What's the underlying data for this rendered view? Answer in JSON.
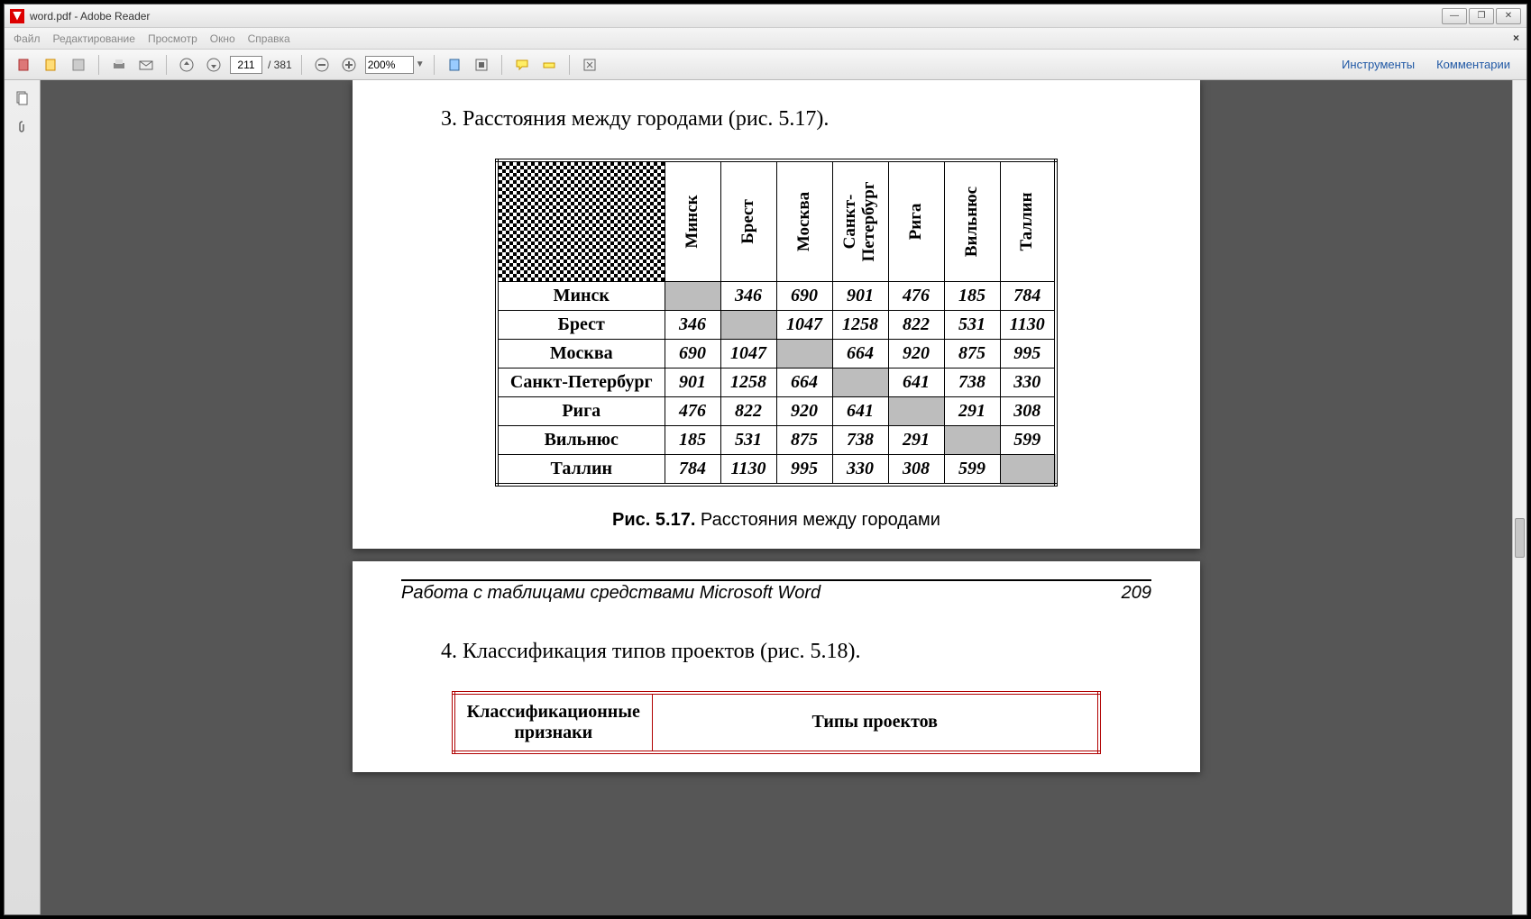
{
  "window": {
    "title": "word.pdf - Adobe Reader"
  },
  "menu": {
    "file": "Файл",
    "edit": "Редактирование",
    "view": "Просмотр",
    "window": "Окно",
    "help": "Справка"
  },
  "toolbar": {
    "page_current": "211",
    "page_total": "/ 381",
    "zoom": "200%",
    "tools": "Инструменты",
    "comments": "Комментарии"
  },
  "doc": {
    "item3": "3.  Расстояния между городами (рис. 5.17).",
    "caption_bold": "Рис. 5.17.",
    "caption_rest": " Расстояния между городами",
    "footer_title": "Работа с таблицами средствами Microsoft Word",
    "footer_page": "209",
    "item4": "4.  Классификация типов проектов (рис. 5.18).",
    "class_col1": "Классификационные признаки",
    "class_col2": "Типы проектов",
    "cities": [
      "Минск",
      "Брест",
      "Москва",
      "Санкт-Петербург",
      "Рига",
      "Вильнюс",
      "Таллин"
    ],
    "city_header_sp": "Санкт-\nПетербург",
    "dist": [
      [
        null,
        346,
        690,
        901,
        476,
        185,
        784
      ],
      [
        346,
        null,
        1047,
        1258,
        822,
        531,
        1130
      ],
      [
        690,
        1047,
        null,
        664,
        920,
        875,
        995
      ],
      [
        901,
        1258,
        664,
        null,
        641,
        738,
        330
      ],
      [
        476,
        822,
        920,
        641,
        null,
        291,
        308
      ],
      [
        185,
        531,
        875,
        738,
        291,
        null,
        599
      ],
      [
        784,
        1130,
        995,
        330,
        308,
        599,
        null
      ]
    ]
  }
}
